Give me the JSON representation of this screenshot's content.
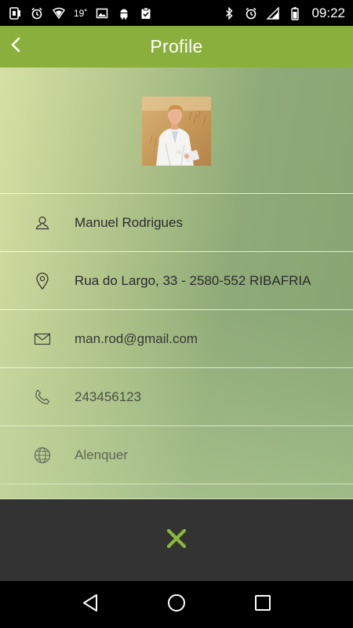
{
  "status_bar": {
    "left_icons": [
      "sim-icon",
      "alarm-icon",
      "wifi-icon"
    ],
    "temperature": "19˚",
    "more_left_icons": [
      "image-icon",
      "android-icon",
      "clipboard-check-icon"
    ],
    "right_icons": [
      "bluetooth-icon",
      "alarm-icon",
      "signal-icon",
      "battery-icon"
    ],
    "time": "09:22"
  },
  "app_bar": {
    "title": "Profile",
    "back_icon": "chevron-left-icon",
    "color": "#8aaf3c"
  },
  "profile": {
    "avatar_icon": "person-photo",
    "fields": [
      {
        "icon": "person-icon",
        "value": "Manuel Rodrigues"
      },
      {
        "icon": "location-pin-icon",
        "value": "Rua do Largo, 33 - 2580-552 RIBAFRIA"
      },
      {
        "icon": "envelope-icon",
        "value": "man.rod@gmail.com"
      },
      {
        "icon": "phone-icon",
        "value": "243456123"
      },
      {
        "icon": "globe-icon",
        "value": "Alenquer"
      }
    ]
  },
  "bottom_panel": {
    "close_icon": "close-icon",
    "accent_color": "#8ab83a"
  },
  "nav_bar": {
    "buttons": [
      "back-triangle-icon",
      "home-circle-icon",
      "recents-square-icon"
    ]
  }
}
